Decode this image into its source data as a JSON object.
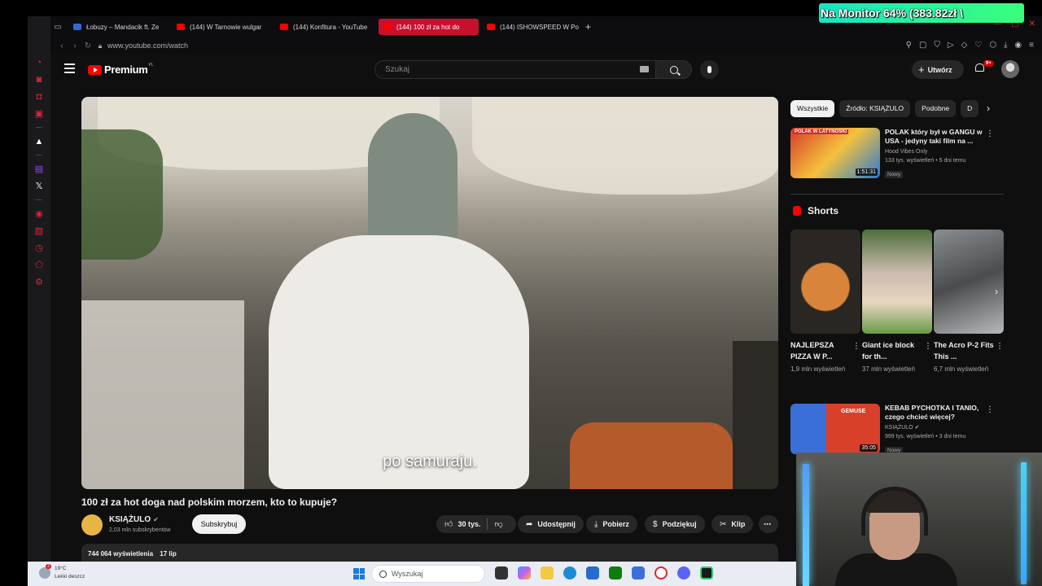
{
  "browser": {
    "tabs": [
      {
        "label": "Łobuzy – Mandacik ft. Ze",
        "favicon": "blue",
        "active": false
      },
      {
        "label": "(144) W Tarnowie wulgar",
        "favicon": "red",
        "active": false
      },
      {
        "label": "(144) Konfitura - YouTube",
        "favicon": "red",
        "active": false
      },
      {
        "label": "(144) 100 zł za hot do",
        "favicon": "red",
        "active": true
      },
      {
        "label": "(144) ISHOWSPEED W Po",
        "favicon": "red",
        "active": false
      }
    ],
    "url": "www.youtube.com/watch"
  },
  "header": {
    "logo_text": "Premium",
    "logo_region": "PL",
    "search_placeholder": "Szukaj",
    "create_label": "Utwórz",
    "notif_badge": "9+"
  },
  "video": {
    "subtitle": "po samuraju.",
    "title": "100 zł za hot doga nad polskim morzem, kto to kupuje?",
    "channel": "KSIĄŻULO",
    "subscribers": "2,03 mln subskrybentów",
    "subscribe_label": "Subskrybuj",
    "likes": "30 tys.",
    "share_label": "Udostępnij",
    "download_label": "Pobierz",
    "thanks_label": "Podziękuj",
    "clip_label": "Klip",
    "views": "744 064 wyświetlenia",
    "date": "17 lip"
  },
  "chips": [
    "Wszystkie",
    "Źródło: KSIĄŻULO",
    "Podobne",
    "D"
  ],
  "recommendations": [
    {
      "title": "POLAK który był w GANGU w USA - jedyny taki film na ...",
      "channel": "Hood Vibes Only",
      "meta": "133 tys. wyświetleń • 5 dni temu",
      "badge": "Nowy",
      "duration": "1:51:31",
      "thumb_label": "POLAK W LATYNOSKI"
    },
    {
      "title": "KEBAB PYCHOTKA I TANIO, czego chcieć więcej?",
      "channel": "KSIĄŻULO",
      "meta": "999 tys. wyświetleń • 3 dni temu",
      "badge": "Nowy",
      "duration": "35:05",
      "thumb_label": "GEMUSE"
    }
  ],
  "shorts": {
    "heading": "Shorts",
    "items": [
      {
        "title": "NAJLEPSZA PIZZA W P...",
        "views": "1,9 mln wyświetleń"
      },
      {
        "title": "Giant ice block for th...",
        "views": "37 mln wyświetleń"
      },
      {
        "title": "The Acro P-2 Fits This ...",
        "views": "6,7 mln wyświetleń"
      }
    ]
  },
  "overlay": {
    "monitor_text": "Na Monitor 64% (383.82zł \\"
  },
  "taskbar": {
    "weather_temp": "19°C",
    "weather_desc": "Lekki deszcz",
    "weather_badge": "3",
    "search_placeholder": "Wyszukaj"
  },
  "colors": {
    "accent": "#ff0000",
    "opera_active_tab": "#c8102e",
    "monitor_gradient": [
      "#19e6c3",
      "#39ff7a"
    ]
  }
}
